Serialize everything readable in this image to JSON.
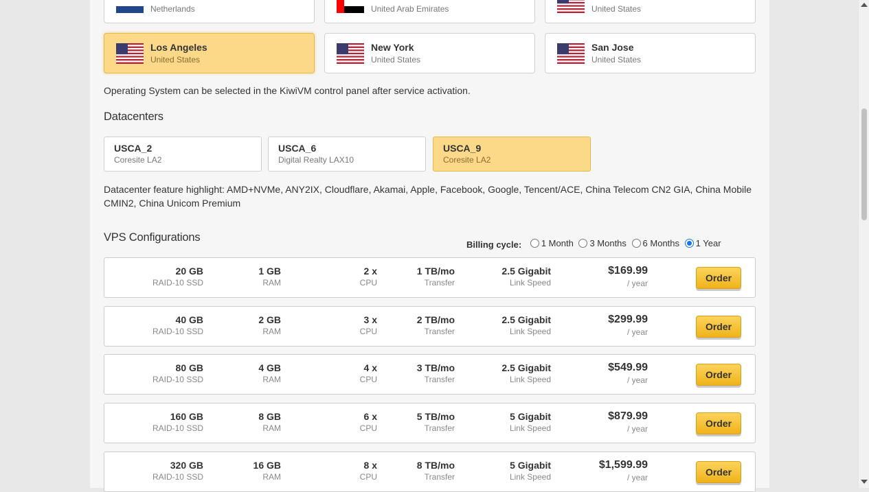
{
  "locations_top": [
    {
      "name": "",
      "country": "Netherlands",
      "flag": "nl-flag-icon"
    },
    {
      "name": "",
      "country": "United Arab Emirates",
      "flag": "uae-flag-icon"
    },
    {
      "name": "",
      "country": "United States",
      "flag": "us-flag-icon"
    }
  ],
  "locations": [
    {
      "name": "Los Angeles",
      "country": "United States",
      "flag": "us-flag-icon",
      "selected": true
    },
    {
      "name": "New York",
      "country": "United States",
      "flag": "us-flag-icon",
      "selected": false
    },
    {
      "name": "San Jose",
      "country": "United States",
      "flag": "us-flag-icon",
      "selected": false
    }
  ],
  "os_note": "Operating System can be selected in the KiwiVM control panel after service activation.",
  "datacenters_title": "Datacenters",
  "datacenters": [
    {
      "name": "USCA_2",
      "sub": "Coresite LA2",
      "selected": false
    },
    {
      "name": "USCA_6",
      "sub": "Digital Realty LAX10",
      "selected": false
    },
    {
      "name": "USCA_9",
      "sub": "Coresite LA2",
      "selected": true
    }
  ],
  "datacenter_note": "Datacenter feature highlight: AMD+NVMe, ANY2IX, Cloudflare, Akamai, Apple, Facebook, Google, Tencent/ACE, China Telecom CN2 GIA, China Mobile CMIN2, China Unicom Premium",
  "vps_title": "VPS Configurations",
  "billing": {
    "label": "Billing cycle:",
    "options": [
      "1 Month",
      "3 Months",
      "6 Months",
      "1 Year"
    ],
    "selected": "1 Year"
  },
  "plans": [
    {
      "disk": "20 GB",
      "disk_l": "RAID-10 SSD",
      "ram": "1 GB",
      "ram_l": "RAM",
      "cpu": "2 x",
      "cpu_l": "CPU",
      "transfer": "1 TB/mo",
      "transfer_l": "Transfer",
      "speed": "2.5 Gigabit",
      "speed_l": "Link Speed",
      "price": "$169.99",
      "period": "/ year",
      "order": "Order"
    },
    {
      "disk": "40 GB",
      "disk_l": "RAID-10 SSD",
      "ram": "2 GB",
      "ram_l": "RAM",
      "cpu": "3 x",
      "cpu_l": "CPU",
      "transfer": "2 TB/mo",
      "transfer_l": "Transfer",
      "speed": "2.5 Gigabit",
      "speed_l": "Link Speed",
      "price": "$299.99",
      "period": "/ year",
      "order": "Order"
    },
    {
      "disk": "80 GB",
      "disk_l": "RAID-10 SSD",
      "ram": "4 GB",
      "ram_l": "RAM",
      "cpu": "4 x",
      "cpu_l": "CPU",
      "transfer": "3 TB/mo",
      "transfer_l": "Transfer",
      "speed": "2.5 Gigabit",
      "speed_l": "Link Speed",
      "price": "$549.99",
      "period": "/ year",
      "order": "Order"
    },
    {
      "disk": "160 GB",
      "disk_l": "RAID-10 SSD",
      "ram": "8 GB",
      "ram_l": "RAM",
      "cpu": "6 x",
      "cpu_l": "CPU",
      "transfer": "5 TB/mo",
      "transfer_l": "Transfer",
      "speed": "5 Gigabit",
      "speed_l": "Link Speed",
      "price": "$879.99",
      "period": "/ year",
      "order": "Order"
    },
    {
      "disk": "320 GB",
      "disk_l": "RAID-10 SSD",
      "ram": "16 GB",
      "ram_l": "RAM",
      "cpu": "8 x",
      "cpu_l": "CPU",
      "transfer": "8 TB/mo",
      "transfer_l": "Transfer",
      "speed": "5 Gigabit",
      "speed_l": "Link Speed",
      "price": "$1,599.99",
      "period": "/ year",
      "order": "Order"
    }
  ],
  "colors": {
    "selected_bg": "#fbd989",
    "order_button": "#f5bf2c",
    "radio_selected": "#1a73e8"
  }
}
